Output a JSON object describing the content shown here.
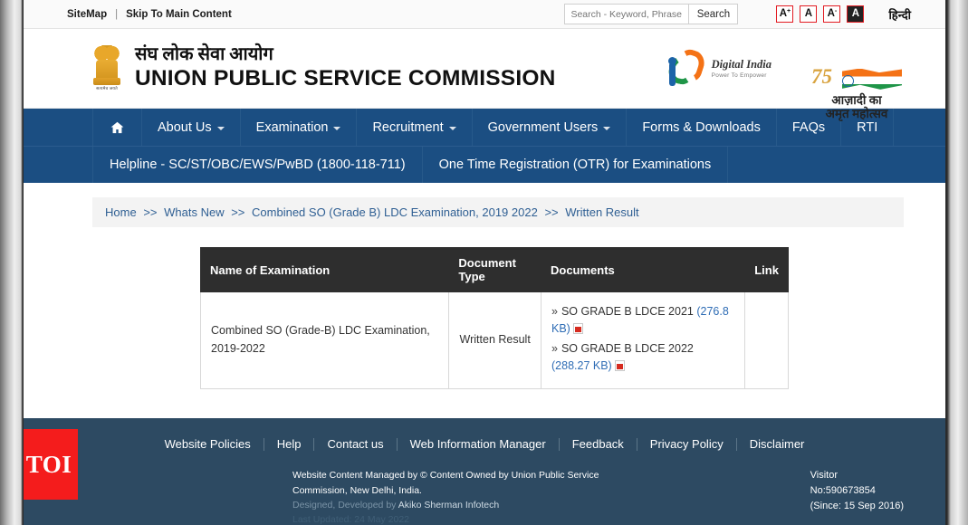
{
  "topbar": {
    "sitemap": "SiteMap",
    "separator": "|",
    "skip": "Skip To Main Content",
    "search_placeholder": "Search - Keyword, Phrase",
    "search_value": "",
    "search_button": "Search",
    "font_increase": "A",
    "font_increase_sup": "+",
    "font_normal": "A",
    "font_decrease": "A",
    "font_decrease_sup": "-",
    "contrast_toggle": "A",
    "hindi": "हिन्दी"
  },
  "masthead": {
    "hindi_title": "संघ लोक सेवा आयोग",
    "english_title": "UNION PUBLIC SERVICE COMMISSION",
    "emblem_motto": "सत्यमेव जयते",
    "digital_india_name": "Digital India",
    "digital_india_tagline": "Power To Empower",
    "azadi_number": "75",
    "azadi_line1": "आज़ादी का",
    "azadi_line2": "अमृत महोत्सव"
  },
  "nav": {
    "primary": [
      {
        "label": "",
        "icon": "home-icon",
        "caret": false,
        "name": "home"
      },
      {
        "label": "About Us",
        "caret": true,
        "name": "about-us"
      },
      {
        "label": "Examination",
        "caret": true,
        "name": "examination"
      },
      {
        "label": "Recruitment",
        "caret": true,
        "name": "recruitment"
      },
      {
        "label": "Government Users",
        "caret": true,
        "name": "government-users"
      },
      {
        "label": "Forms & Downloads",
        "caret": false,
        "name": "forms-downloads"
      },
      {
        "label": "FAQs",
        "caret": false,
        "name": "faqs"
      },
      {
        "label": "RTI",
        "caret": false,
        "name": "rti"
      }
    ],
    "secondary": [
      {
        "label": "Helpline - SC/ST/OBC/EWS/PwBD (1800-118-711)",
        "name": "helpline"
      },
      {
        "label": "One Time Registration (OTR) for Examinations",
        "name": "otr"
      }
    ]
  },
  "breadcrumb": {
    "items": [
      "Home",
      "Whats New",
      "Combined SO (Grade B) LDC Examination, 2019 2022",
      "Written Result"
    ],
    "separator": ">>"
  },
  "table": {
    "headers": [
      "Name of Examination",
      "Document Type",
      "Documents",
      "Link"
    ],
    "rows": [
      {
        "name": "Combined SO (Grade-B) LDC Examination, 2019-2022",
        "document_type": "Written Result",
        "documents": [
          {
            "bullet": "»",
            "label": "SO GRADE B LDCE 2021",
            "size": "(276.8 KB)",
            "icon": "pdf-icon"
          },
          {
            "bullet": "»",
            "label": "SO GRADE B LDCE 2022",
            "size": "(288.27 KB)",
            "icon": "pdf-icon"
          }
        ],
        "link": ""
      }
    ]
  },
  "footer": {
    "links": [
      "Website Policies",
      "Help",
      "Contact us",
      "Web Information Manager",
      "Feedback",
      "Privacy Policy",
      "Disclaimer"
    ],
    "content_line1": "Website Content Managed by © Content Owned by Union Public Service",
    "content_line2": "Commission, New Delhi, India.",
    "designed_prefix": "Designed, Developed by",
    "designed_by": "Akiko Sherman Infotech",
    "last_updated": "Last Updated: 24 May 2022",
    "visitor_label": "Visitor",
    "visitor_number": "No:590673854",
    "visitor_since": "(Since: 15 Sep 2016)"
  },
  "watermark": {
    "text": "TOI"
  },
  "colors": {
    "nav_blue": "#1b4e82",
    "footer_blue": "#2d4a62",
    "table_header": "#2e2e2e",
    "accent_red": "#e21b22",
    "link_blue": "#2f6db5",
    "watermark_red": "#f41c1c"
  }
}
